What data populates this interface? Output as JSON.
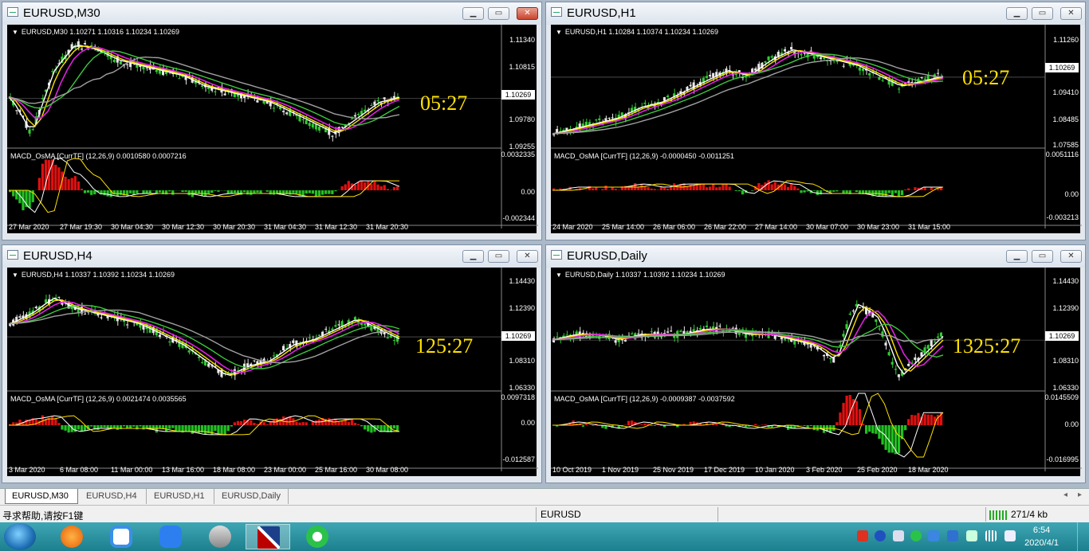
{
  "windows": [
    {
      "id": "m30",
      "title": "EURUSD,M30",
      "header": "EURUSD,M30  1.10271 1.10316 1.10234 1.10269",
      "indicator": "MACD_OsMA [CurrTF] (12,26,9) 0.0010580 0.0007216",
      "timer": "05:27",
      "price_labels": [
        "1.11340",
        "1.10815",
        "1.10269",
        "1.09780",
        "1.09255"
      ],
      "current_price": "1.10269",
      "macd_labels": [
        "0.0032335",
        "0.00",
        "-0.002344"
      ],
      "time_labels": [
        "27 Mar 2020",
        "27 Mar 19:30",
        "30 Mar 04:30",
        "30 Mar 12:30",
        "30 Mar 20:30",
        "31 Mar 04:30",
        "31 Mar 12:30",
        "31 Mar 20:30"
      ],
      "active": true
    },
    {
      "id": "h1",
      "title": "EURUSD,H1",
      "header": "EURUSD,H1  1.10284 1.10374 1.10234 1.10269",
      "indicator": "MACD_OsMA [CurrTF] (12,26,9) -0.0000450 -0.0011251",
      "timer": "05:27",
      "price_labels": [
        "1.11260",
        "1.10269",
        "1.09410",
        "1.08485",
        "1.07585"
      ],
      "current_price": "1.10269",
      "macd_labels": [
        "0.0051116",
        "0.00",
        "-0.003213"
      ],
      "time_labels": [
        "24 Mar 2020",
        "25 Mar 14:00",
        "26 Mar 06:00",
        "26 Mar 22:00",
        "27 Mar 14:00",
        "30 Mar 07:00",
        "30 Mar 23:00",
        "31 Mar 15:00"
      ],
      "active": false
    },
    {
      "id": "h4",
      "title": "EURUSD,H4",
      "header": "EURUSD,H4  1.10337 1.10392 1.10234 1.10269",
      "indicator": "MACD_OsMA [CurrTF] (12,26,9) 0.0021474 0.0035565",
      "timer": "125:27",
      "price_labels": [
        "1.14430",
        "1.12390",
        "1.10269",
        "1.08310",
        "1.06330"
      ],
      "current_price": "1.10269",
      "macd_labels": [
        "0.0097318",
        "0.00",
        "-0.012587"
      ],
      "time_labels": [
        "3 Mar 2020",
        "6 Mar 08:00",
        "11 Mar 00:00",
        "13 Mar 16:00",
        "18 Mar 08:00",
        "23 Mar 00:00",
        "25 Mar 16:00",
        "30 Mar 08:00"
      ],
      "active": false
    },
    {
      "id": "daily",
      "title": "EURUSD,Daily",
      "header": "EURUSD,Daily  1.10337 1.10392 1.10234 1.10269",
      "indicator": "MACD_OsMA [CurrTF] (12,26,9) -0.0009387 -0.0037592",
      "timer": "1325:27",
      "price_labels": [
        "1.14430",
        "1.12390",
        "1.10269",
        "1.08310",
        "1.06330"
      ],
      "current_price": "1.10269",
      "macd_labels": [
        "0.0145509",
        "0.00",
        "-0.016995"
      ],
      "time_labels": [
        "10 Oct 2019",
        "1 Nov 2019",
        "25 Nov 2019",
        "17 Dec 2019",
        "10 Jan 2020",
        "3 Feb 2020",
        "25 Feb 2020",
        "18 Mar 2020"
      ],
      "active": false
    }
  ],
  "tabs": [
    "EURUSD,M30",
    "EURUSD,H4",
    "EURUSD,H1",
    "EURUSD,Daily"
  ],
  "status": {
    "help": "寻求帮助,请按F1键",
    "symbol": "EURUSD",
    "traffic": "271/4 kb"
  },
  "taskbar": {
    "time": "6:54",
    "date": "2020/4/1"
  },
  "colors": {
    "bull": "#33cc33",
    "bear": "#e8e8e8",
    "ma_fast": "#ffffff",
    "ma_2": "#ffe000",
    "ma_3": "#e020e0",
    "ma_4": "#3cc83c",
    "ma_5": "#a0a0a0",
    "hist_pos": "#e01010",
    "hist_neg": "#22c022",
    "timer": "#ffe200"
  }
}
